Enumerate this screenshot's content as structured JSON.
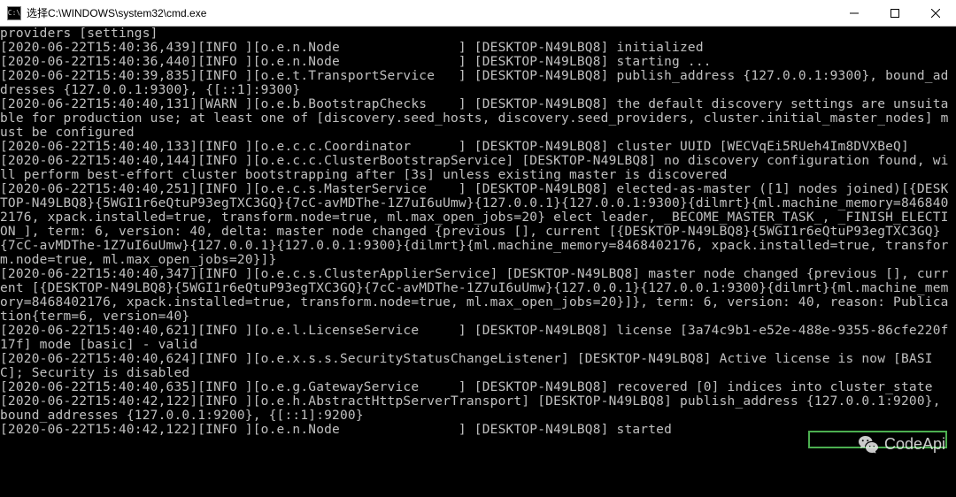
{
  "window": {
    "title": "选择C:\\WINDOWS\\system32\\cmd.exe",
    "icon_label": "C:\\"
  },
  "terminal": {
    "lines": [
      "providers [settings]",
      "[2020-06-22T15:40:36,439][INFO ][o.e.n.Node               ] [DESKTOP-N49LBQ8] initialized",
      "[2020-06-22T15:40:36,440][INFO ][o.e.n.Node               ] [DESKTOP-N49LBQ8] starting ...",
      "[2020-06-22T15:40:39,835][INFO ][o.e.t.TransportService   ] [DESKTOP-N49LBQ8] publish_address {127.0.0.1:9300}, bound_addresses {127.0.0.1:9300}, {[::1]:9300}",
      "[2020-06-22T15:40:40,131][WARN ][o.e.b.BootstrapChecks    ] [DESKTOP-N49LBQ8] the default discovery settings are unsuitable for production use; at least one of [discovery.seed_hosts, discovery.seed_providers, cluster.initial_master_nodes] must be configured",
      "[2020-06-22T15:40:40,133][INFO ][o.e.c.c.Coordinator      ] [DESKTOP-N49LBQ8] cluster UUID [WECVqEi5RUeh4Im8DVXBeQ]",
      "[2020-06-22T15:40:40,144][INFO ][o.e.c.c.ClusterBootstrapService] [DESKTOP-N49LBQ8] no discovery configuration found, will perform best-effort cluster bootstrapping after [3s] unless existing master is discovered",
      "[2020-06-22T15:40:40,251][INFO ][o.e.c.s.MasterService    ] [DESKTOP-N49LBQ8] elected-as-master ([1] nodes joined)[{DESKTOP-N49LBQ8}{5WGI1r6eQtuP93egTXC3GQ}{7cC-avMDThe-1Z7uI6uUmw}{127.0.0.1}{127.0.0.1:9300}{dilmrt}{ml.machine_memory=8468402176, xpack.installed=true, transform.node=true, ml.max_open_jobs=20} elect leader, _BECOME_MASTER_TASK_, _FINISH_ELECTION_], term: 6, version: 40, delta: master node changed {previous [], current [{DESKTOP-N49LBQ8}{5WGI1r6eQtuP93egTXC3GQ}{7cC-avMDThe-1Z7uI6uUmw}{127.0.0.1}{127.0.0.1:9300}{dilmrt}{ml.machine_memory=8468402176, xpack.installed=true, transform.node=true, ml.max_open_jobs=20}]}",
      "[2020-06-22T15:40:40,347][INFO ][o.e.c.s.ClusterApplierService] [DESKTOP-N49LBQ8] master node changed {previous [], current [{DESKTOP-N49LBQ8}{5WGI1r6eQtuP93egTXC3GQ}{7cC-avMDThe-1Z7uI6uUmw}{127.0.0.1}{127.0.0.1:9300}{dilmrt}{ml.machine_memory=8468402176, xpack.installed=true, transform.node=true, ml.max_open_jobs=20}]}, term: 6, version: 40, reason: Publication{term=6, version=40}",
      "[2020-06-22T15:40:40,621][INFO ][o.e.l.LicenseService     ] [DESKTOP-N49LBQ8] license [3a74c9b1-e52e-488e-9355-86cfe220f17f] mode [basic] - valid",
      "[2020-06-22T15:40:40,624][INFO ][o.e.x.s.s.SecurityStatusChangeListener] [DESKTOP-N49LBQ8] Active license is now [BASIC]; Security is disabled",
      "[2020-06-22T15:40:40,635][INFO ][o.e.g.GatewayService     ] [DESKTOP-N49LBQ8] recovered [0] indices into cluster_state",
      "[2020-06-22T15:40:42,122][INFO ][o.e.h.AbstractHttpServerTransport] [DESKTOP-N49LBQ8] publish_address {127.0.0.1:9200}, bound_addresses {127.0.0.1:9200}, {[::1]:9200}",
      "[2020-06-22T15:40:42,122][INFO ][o.e.n.Node               ] [DESKTOP-N49LBQ8] started"
    ]
  },
  "watermark": {
    "text": "CodeApi"
  },
  "highlight": {
    "target": "127.0.0.1:9200"
  }
}
